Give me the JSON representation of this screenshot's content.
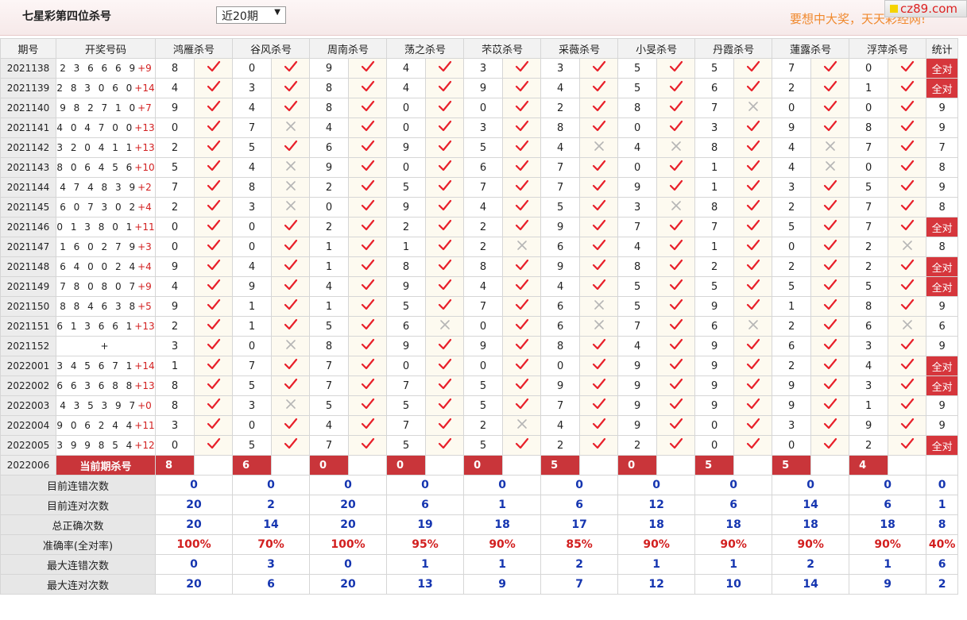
{
  "header": {
    "title": "七星彩第四位杀号",
    "period": "近20期",
    "slogan": "要想中大奖，天天彩经网!",
    "logo": "cz89.com"
  },
  "columns": {
    "issue": "期号",
    "draw": "开奖号码",
    "experts": [
      "鸿雁杀号",
      "谷风杀号",
      "周南杀号",
      "荡之杀号",
      "芣苡杀号",
      "采薇杀号",
      "小旻杀号",
      "丹霞杀号",
      "蓮露杀号",
      "浮萍杀号"
    ],
    "stats": "统计"
  },
  "rows": [
    {
      "issue": "2021138",
      "digits": "2 3 6 6 6 9",
      "extra": "+9",
      "kills": [
        8,
        0,
        9,
        4,
        3,
        3,
        5,
        5,
        7,
        0
      ],
      "ok": [
        1,
        1,
        1,
        1,
        1,
        1,
        1,
        1,
        1,
        1
      ],
      "stat": "全对"
    },
    {
      "issue": "2021139",
      "digits": "2 8 3 0 6 0",
      "extra": "+14",
      "kills": [
        4,
        3,
        8,
        4,
        9,
        4,
        5,
        6,
        2,
        1
      ],
      "ok": [
        1,
        1,
        1,
        1,
        1,
        1,
        1,
        1,
        1,
        1
      ],
      "stat": "全对"
    },
    {
      "issue": "2021140",
      "digits": "9 8 2 7 1 0",
      "extra": "+7",
      "kills": [
        9,
        4,
        8,
        0,
        0,
        2,
        8,
        7,
        0,
        0
      ],
      "ok": [
        1,
        1,
        1,
        1,
        1,
        1,
        1,
        0,
        1,
        1
      ],
      "stat": "9"
    },
    {
      "issue": "2021141",
      "digits": "4 0 4 7 0 0",
      "extra": "+13",
      "kills": [
        0,
        7,
        4,
        0,
        3,
        8,
        0,
        3,
        9,
        8
      ],
      "ok": [
        1,
        0,
        1,
        1,
        1,
        1,
        1,
        1,
        1,
        1
      ],
      "stat": "9"
    },
    {
      "issue": "2021142",
      "digits": "3 2 0 4 1 1",
      "extra": "+13",
      "kills": [
        2,
        5,
        6,
        9,
        5,
        4,
        4,
        8,
        4,
        7
      ],
      "ok": [
        1,
        1,
        1,
        1,
        1,
        0,
        0,
        1,
        0,
        1
      ],
      "stat": "7"
    },
    {
      "issue": "2021143",
      "digits": "8 0 6 4 5 6",
      "extra": "+10",
      "kills": [
        5,
        4,
        9,
        0,
        6,
        7,
        0,
        1,
        4,
        0
      ],
      "ok": [
        1,
        0,
        1,
        1,
        1,
        1,
        1,
        1,
        0,
        1
      ],
      "stat": "8"
    },
    {
      "issue": "2021144",
      "digits": "4 7 4 8 3 9",
      "extra": "+2",
      "kills": [
        7,
        8,
        2,
        5,
        7,
        7,
        9,
        1,
        3,
        5
      ],
      "ok": [
        1,
        0,
        1,
        1,
        1,
        1,
        1,
        1,
        1,
        1
      ],
      "stat": "9"
    },
    {
      "issue": "2021145",
      "digits": "6 0 7 3 0 2",
      "extra": "+4",
      "kills": [
        2,
        3,
        0,
        9,
        4,
        5,
        3,
        8,
        2,
        7
      ],
      "ok": [
        1,
        0,
        1,
        1,
        1,
        1,
        0,
        1,
        1,
        1
      ],
      "stat": "8"
    },
    {
      "issue": "2021146",
      "digits": "0 1 3 8 0 1",
      "extra": "+11",
      "kills": [
        0,
        0,
        2,
        2,
        2,
        9,
        7,
        7,
        5,
        7
      ],
      "ok": [
        1,
        1,
        1,
        1,
        1,
        1,
        1,
        1,
        1,
        1
      ],
      "stat": "全对"
    },
    {
      "issue": "2021147",
      "digits": "1 6 0 2 7 9",
      "extra": "+3",
      "kills": [
        0,
        0,
        1,
        1,
        2,
        6,
        4,
        1,
        0,
        2
      ],
      "ok": [
        1,
        1,
        1,
        1,
        0,
        1,
        1,
        1,
        1,
        0
      ],
      "stat": "8"
    },
    {
      "issue": "2021148",
      "digits": "6 4 0 0 2 4",
      "extra": "+4",
      "kills": [
        9,
        4,
        1,
        8,
        8,
        9,
        8,
        2,
        2,
        2
      ],
      "ok": [
        1,
        1,
        1,
        1,
        1,
        1,
        1,
        1,
        1,
        1
      ],
      "stat": "全对"
    },
    {
      "issue": "2021149",
      "digits": "7 8 0 8 0 7",
      "extra": "+9",
      "kills": [
        4,
        9,
        4,
        9,
        4,
        4,
        5,
        5,
        5,
        5
      ],
      "ok": [
        1,
        1,
        1,
        1,
        1,
        1,
        1,
        1,
        1,
        1
      ],
      "stat": "全对"
    },
    {
      "issue": "2021150",
      "digits": "8 8 4 6 3 8",
      "extra": "+5",
      "kills": [
        9,
        1,
        1,
        5,
        7,
        6,
        5,
        9,
        1,
        8
      ],
      "ok": [
        1,
        1,
        1,
        1,
        1,
        0,
        1,
        1,
        1,
        1
      ],
      "stat": "9"
    },
    {
      "issue": "2021151",
      "digits": "6 1 3 6 6 1",
      "extra": "+13",
      "kills": [
        2,
        1,
        5,
        6,
        0,
        6,
        7,
        6,
        2,
        6
      ],
      "ok": [
        1,
        1,
        1,
        0,
        1,
        0,
        1,
        0,
        1,
        0
      ],
      "stat": "6"
    },
    {
      "issue": "2021152",
      "digits": "+",
      "extra": "",
      "kills": [
        3,
        0,
        8,
        9,
        9,
        8,
        4,
        9,
        6,
        3
      ],
      "ok": [
        1,
        0,
        1,
        1,
        1,
        1,
        1,
        1,
        1,
        1
      ],
      "stat": "9"
    },
    {
      "issue": "2022001",
      "digits": "3 4 5 6 7 1",
      "extra": "+14",
      "kills": [
        1,
        7,
        7,
        0,
        0,
        0,
        9,
        9,
        2,
        4
      ],
      "ok": [
        1,
        1,
        1,
        1,
        1,
        1,
        1,
        1,
        1,
        1
      ],
      "stat": "全对"
    },
    {
      "issue": "2022002",
      "digits": "6 6 3 6 8 8",
      "extra": "+13",
      "kills": [
        8,
        5,
        7,
        7,
        5,
        9,
        9,
        9,
        9,
        3
      ],
      "ok": [
        1,
        1,
        1,
        1,
        1,
        1,
        1,
        1,
        1,
        1
      ],
      "stat": "全对"
    },
    {
      "issue": "2022003",
      "digits": "4 3 5 3 9 7",
      "extra": "+0",
      "kills": [
        8,
        3,
        5,
        5,
        5,
        7,
        9,
        9,
        9,
        1
      ],
      "ok": [
        1,
        0,
        1,
        1,
        1,
        1,
        1,
        1,
        1,
        1
      ],
      "stat": "9"
    },
    {
      "issue": "2022004",
      "digits": "9 0 6 2 4 4",
      "extra": "+11",
      "kills": [
        3,
        0,
        4,
        7,
        2,
        4,
        9,
        0,
        3,
        9
      ],
      "ok": [
        1,
        1,
        1,
        1,
        0,
        1,
        1,
        1,
        1,
        1
      ],
      "stat": "9"
    },
    {
      "issue": "2022005",
      "digits": "3 9 9 8 5 4",
      "extra": "+12",
      "kills": [
        0,
        5,
        7,
        5,
        5,
        2,
        2,
        0,
        0,
        2
      ],
      "ok": [
        1,
        1,
        1,
        1,
        1,
        1,
        1,
        1,
        1,
        1
      ],
      "stat": "全对"
    }
  ],
  "current": {
    "issue": "2022006",
    "label": "当前期杀号",
    "kills": [
      8,
      6,
      0,
      0,
      0,
      5,
      0,
      5,
      5,
      4
    ]
  },
  "summary": [
    {
      "label": "目前连错次数",
      "values": [
        "0",
        "0",
        "0",
        "0",
        "0",
        "0",
        "0",
        "0",
        "0",
        "0"
      ],
      "stat": "0",
      "red": false
    },
    {
      "label": "目前连对次数",
      "values": [
        "20",
        "2",
        "20",
        "6",
        "1",
        "6",
        "12",
        "6",
        "14",
        "6"
      ],
      "stat": "1",
      "red": false
    },
    {
      "label": "总正确次数",
      "values": [
        "20",
        "14",
        "20",
        "19",
        "18",
        "17",
        "18",
        "18",
        "18",
        "18"
      ],
      "stat": "8",
      "red": false
    },
    {
      "label": "准确率(全对率)",
      "values": [
        "100%",
        "70%",
        "100%",
        "95%",
        "90%",
        "85%",
        "90%",
        "90%",
        "90%",
        "90%"
      ],
      "stat": "40%",
      "red": true
    },
    {
      "label": "最大连错次数",
      "values": [
        "0",
        "3",
        "0",
        "1",
        "1",
        "2",
        "1",
        "1",
        "2",
        "1"
      ],
      "stat": "6",
      "red": false
    },
    {
      "label": "最大连对次数",
      "values": [
        "20",
        "6",
        "20",
        "13",
        "9",
        "7",
        "12",
        "10",
        "14",
        "9"
      ],
      "stat": "2",
      "red": false
    }
  ],
  "colors": {
    "tick": "#e8202a",
    "cross": "#b5b5b5",
    "accent": "#c9353a",
    "summary_value": "#1535b0"
  },
  "icons": {
    "right": "check-icon",
    "wrong": "cross-icon",
    "dropdown": "chevron-down-icon"
  }
}
